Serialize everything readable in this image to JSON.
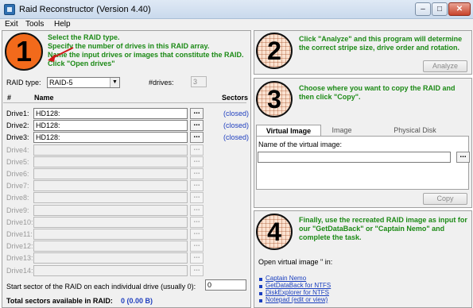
{
  "window": {
    "title": "Raid Reconstructor (Version 4.40)",
    "min": "–",
    "max": "□",
    "close": "✕"
  },
  "menu": [
    "Exit",
    "Tools",
    "Help"
  ],
  "step1": {
    "number": "1",
    "lines": [
      "Select the RAID type.",
      "Specify the number of drives in this RAID array.",
      "Name the input drives or images that constitute the RAID.",
      "Click \"Open drives\""
    ],
    "raid_type_label": "RAID type:",
    "raid_type_value": "RAID-5",
    "drives_label": "#drives:",
    "drives_value": "3",
    "col_num": "#",
    "col_name": "Name",
    "col_sectors": "Sectors",
    "drives": [
      {
        "label": "Drive1:",
        "name": "HD128:",
        "status": "(closed)"
      },
      {
        "label": "Drive2:",
        "name": "HD128:",
        "status": "(closed)"
      },
      {
        "label": "Drive3:",
        "name": "HD128:",
        "status": "(closed)"
      },
      {
        "label": "Drive4:",
        "name": "",
        "status": ""
      },
      {
        "label": "Drive5:",
        "name": "",
        "status": ""
      },
      {
        "label": "Drive6:",
        "name": "",
        "status": ""
      },
      {
        "label": "Drive7:",
        "name": "",
        "status": ""
      },
      {
        "label": "Drive8:",
        "name": "",
        "status": ""
      },
      {
        "label": "Drive9:",
        "name": "",
        "status": ""
      },
      {
        "label": "Drive10:",
        "name": "",
        "status": ""
      },
      {
        "label": "Drive11:",
        "name": "",
        "status": ""
      },
      {
        "label": "Drive12:",
        "name": "",
        "status": ""
      },
      {
        "label": "Drive13:",
        "name": "",
        "status": ""
      },
      {
        "label": "Drive14:",
        "name": "",
        "status": ""
      }
    ],
    "browse": "...",
    "start_sector_label": "Start sector of the RAID on each individual drive (usually 0):",
    "start_sector_value": "0",
    "total_label": "Total sectors available in RAID:",
    "total_value": "0 (0.00 B)"
  },
  "step2": {
    "number": "2",
    "text": "Click \"Analyze\" and this program will determine the correct stripe size, drive order and rotation.",
    "button": "Analyze"
  },
  "step3": {
    "number": "3",
    "text": "Choose where you want to copy the RAID and then click \"Copy\".",
    "tabs": [
      "Virtual Image",
      "Image",
      "Physical Disk"
    ],
    "vi_label": "Name of the virtual image:",
    "vi_value": "",
    "browse": "...",
    "button": "Copy"
  },
  "step4": {
    "number": "4",
    "text": "Finally, use the recreated RAID image as input for our \"GetDataBack\" or \"Captain Nemo\" and complete the task.",
    "open_label": "Open virtual image \" in:",
    "links": [
      "Captain Nemo",
      "GetDataBack for NTFS",
      "DiskExplorer for NTFS",
      "Notepad (edit or view)"
    ]
  },
  "colors": {
    "accent_green": "#1c8a16",
    "orange_circle": "#f26a1b",
    "link_blue": "#1a3fbf"
  }
}
